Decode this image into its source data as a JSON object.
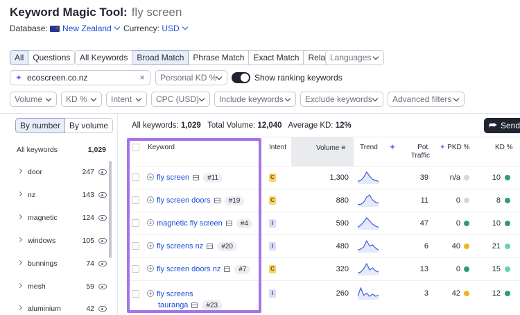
{
  "header": {
    "tool": "Keyword Magic Tool:",
    "query": "fly screen"
  },
  "meta": {
    "database_label": "Database:",
    "database_value": "New Zealand",
    "currency_label": "Currency:",
    "currency_value": "USD"
  },
  "match_tabs": [
    "All",
    "Questions"
  ],
  "match_types": [
    "All Keywords",
    "Broad Match",
    "Phrase Match",
    "Exact Match",
    "Related"
  ],
  "languages": "Languages",
  "domain_input": "ecoscreen.co.nz",
  "personal_kd": "Personal KD %",
  "toggle_label": "Show ranking keywords",
  "filters": [
    "Volume",
    "KD %",
    "Intent",
    "CPC (USD)",
    "Include keywords",
    "Exclude keywords",
    "Advanced filters"
  ],
  "sidebar": {
    "mode": [
      "By number",
      "By volume"
    ],
    "all_label": "All keywords",
    "all_count": "1,029",
    "groups": [
      {
        "label": "door",
        "count": "247"
      },
      {
        "label": "nz",
        "count": "143"
      },
      {
        "label": "magnetic",
        "count": "124"
      },
      {
        "label": "windows",
        "count": "105"
      },
      {
        "label": "bunnings",
        "count": "74"
      },
      {
        "label": "mesh",
        "count": "59"
      },
      {
        "label": "aluminium",
        "count": "42"
      }
    ]
  },
  "summary": {
    "all_label": "All keywords:",
    "all_value": "1,029",
    "vol_label": "Total Volume:",
    "vol_value": "12,040",
    "kd_label": "Average KD:",
    "kd_value": "12%"
  },
  "send_label": "Send",
  "columns": {
    "keyword": "Keyword",
    "intent": "Intent",
    "volume": "Volume",
    "trend": "Trend",
    "pot_traffic_1": "Pot.",
    "pot_traffic_2": "Traffic",
    "pkd": "PKD %",
    "kd": "KD %"
  },
  "rows": [
    {
      "keyword": "fly screen",
      "pos": "#11",
      "intent": "C",
      "volume": "1,300",
      "traffic": "39",
      "pkd": "n/a",
      "kd": "10",
      "pkd_color": "#d5d7dc",
      "kd_color": "#2e9e6e",
      "trend": [
        0.1,
        0.2,
        0.5,
        1,
        0.6,
        0.3,
        0.2,
        0.1
      ]
    },
    {
      "keyword": "fly screen doors",
      "pos": "#19",
      "intent": "C",
      "volume": "880",
      "traffic": "11",
      "pkd": "0",
      "kd": "8",
      "pkd_color": "#d5d7dc",
      "kd_color": "#2e9e6e",
      "trend": [
        0.1,
        0.1,
        0.3,
        0.8,
        1,
        0.5,
        0.3,
        0.2
      ]
    },
    {
      "keyword": "magnetic fly screen",
      "pos": "#4",
      "intent": "I",
      "volume": "590",
      "traffic": "47",
      "pkd": "0",
      "kd": "10",
      "pkd_color": "#2e9e6e",
      "kd_color": "#2e9e6e",
      "trend": [
        0.1,
        0.3,
        0.6,
        1,
        0.7,
        0.4,
        0.2,
        0.1
      ]
    },
    {
      "keyword": "fly screens nz",
      "pos": "#20",
      "intent": "I",
      "volume": "480",
      "traffic": "6",
      "pkd": "40",
      "kd": "21",
      "pkd_color": "#f0b429",
      "kd_color": "#66d4a8",
      "trend": [
        0.1,
        0.2,
        0.4,
        1,
        0.5,
        0.6,
        0.3,
        0.1
      ]
    },
    {
      "keyword": "fly screen doors nz",
      "pos": "#7",
      "intent": "C",
      "volume": "320",
      "traffic": "13",
      "pkd": "0",
      "kd": "15",
      "pkd_color": "#2e9e6e",
      "kd_color": "#66d4a8",
      "trend": [
        0.1,
        0.2,
        0.5,
        1,
        0.4,
        0.6,
        0.3,
        0.2
      ]
    },
    {
      "keyword_1": "fly screens",
      "keyword_2": "tauranga",
      "pos": "#23",
      "intent": "I",
      "volume": "260",
      "traffic": "3",
      "pkd": "42",
      "kd": "12",
      "pkd_color": "#f0b429",
      "kd_color": "#2e9e6e",
      "trend": [
        0.2,
        1,
        0.3,
        0.5,
        0.2,
        0.4,
        0.2,
        0.3
      ]
    }
  ],
  "colors": {
    "accent": "#a574e8",
    "link": "#1a4fd8",
    "intent_c": "#f8d36b",
    "intent_i": "#d9dcf7"
  }
}
